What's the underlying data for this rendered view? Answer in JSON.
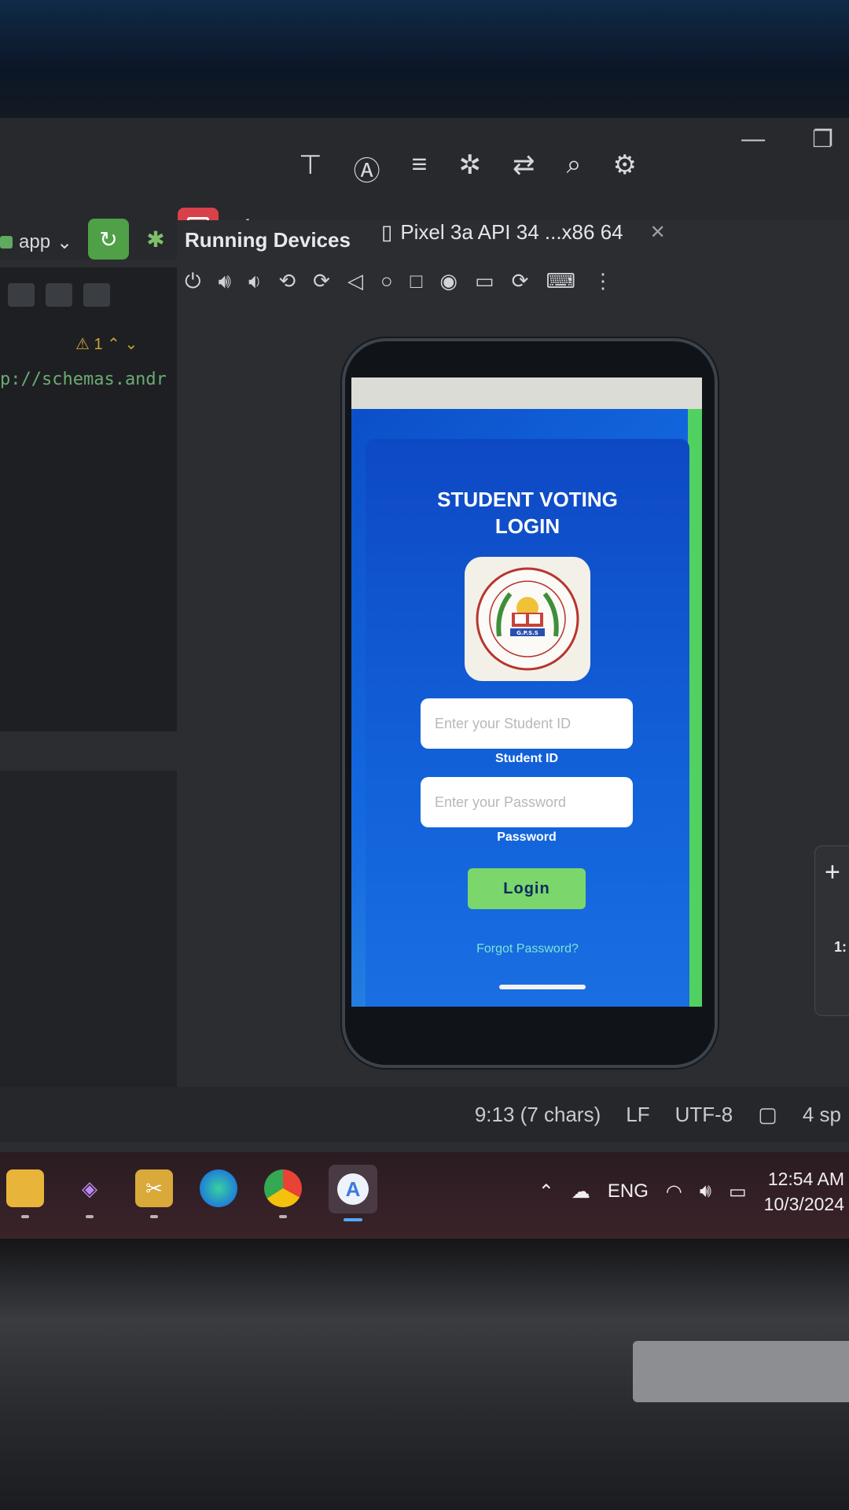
{
  "ide": {
    "run_config": "app",
    "panel_title": "Running Devices",
    "device_tab": "Pixel 3a API 34 ...x86 64",
    "code_line": "p://schemas.andr",
    "warning_count": "1"
  },
  "phone_app": {
    "title_line1": "STUDENT VOTING",
    "title_line2": "LOGIN",
    "student_id_placeholder": "Enter your Student ID",
    "student_id_label": "Student ID",
    "password_placeholder": "Enter your Password",
    "password_label": "Password",
    "login_button": "Login",
    "forgot_password": "Forgot Password?",
    "logo_text": "G.P.S.S",
    "colors": {
      "background": "#1262da",
      "button": "#7bd66b",
      "accent": "#52d163",
      "link": "#7fe3d6"
    }
  },
  "zoom": {
    "ratio": "1:"
  },
  "status_bar": {
    "position": "9:13 (7 chars)",
    "line_ending": "LF",
    "encoding": "UTF-8",
    "indent": "4 sp"
  },
  "taskbar": {
    "apps": [
      "file-explorer-icon",
      "visual-studio-icon",
      "tool-app-icon",
      "edge-icon",
      "chrome-icon",
      "android-studio-icon"
    ],
    "language": "ENG",
    "time": "12:54 AM",
    "date": "10/3/2024"
  }
}
